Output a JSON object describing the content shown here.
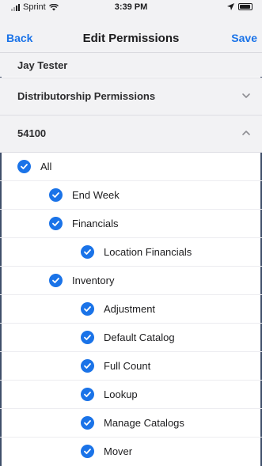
{
  "status_bar": {
    "carrier": "Sprint",
    "time": "3:39 PM"
  },
  "nav": {
    "back_label": "Back",
    "title": "Edit Permissions",
    "save_label": "Save"
  },
  "user": {
    "name": "Jay Tester"
  },
  "sections": [
    {
      "label": "Distributorship Permissions",
      "expanded": false
    },
    {
      "label": "54100",
      "expanded": true
    }
  ],
  "permissions": [
    {
      "label": "All",
      "checked": true
    },
    {
      "label": "End Week",
      "checked": true
    },
    {
      "label": "Financials",
      "checked": true
    },
    {
      "label": "Location Financials",
      "checked": true
    },
    {
      "label": "Inventory",
      "checked": true
    },
    {
      "label": "Adjustment",
      "checked": true
    },
    {
      "label": "Default Catalog",
      "checked": true
    },
    {
      "label": "Full Count",
      "checked": true
    },
    {
      "label": "Lookup",
      "checked": true
    },
    {
      "label": "Manage Catalogs",
      "checked": true
    },
    {
      "label": "Mover",
      "checked": true
    }
  ],
  "colors": {
    "accent": "#1a73e8",
    "header_bg": "#f2f2f4"
  }
}
